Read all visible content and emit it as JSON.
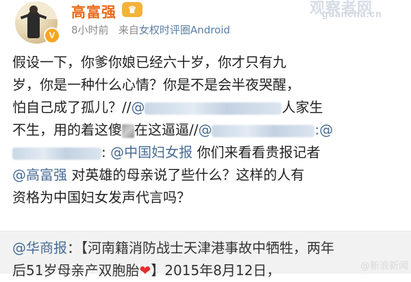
{
  "header": {
    "username": "高富强",
    "vip_badge": "VIP",
    "verified_badge": "V",
    "time": "8小时前",
    "source_prefix": "来自",
    "source": "女权时评圈Android",
    "watermark_site": "观察者网",
    "watermark_url": "guancha.cn"
  },
  "post": {
    "lines": [
      {
        "text": "假设一下，你爹你娘已经六十岁，你才只有九"
      },
      {
        "text": "岁，你是一种什么心情？你是不是会半夜哭醒，"
      },
      {
        "pre": "怕自己成了孤儿？//",
        "mention": "@",
        "post": "人家生"
      },
      {
        "pre": "不生，用的着这傻",
        "post": "在这逼逼//",
        "mention": "@",
        "tail": ":@"
      },
      {
        "lead": ": ",
        "mention": "@中国妇女报",
        "post": " 你们来看看贵报记者"
      },
      {
        "mention": "@高富强",
        "post": " 对英雄的母亲说了些什么？这样的人有"
      },
      {
        "text": "资格为中国妇女发声代言吗？"
      }
    ]
  },
  "repost": {
    "mention": "@华商报",
    "line1_rest": "：【河南籍消防战士天津港事故中牺牲，两年",
    "line2_pre": "后51岁母亲产双胞胎",
    "heart": "❤",
    "line2_post": "】2015年8月12日，",
    "watermark": "@新浪新闻"
  },
  "colors": {
    "username": "#e86a1b",
    "link": "#486c94",
    "meta": "#8a8a8a",
    "repost_bg": "#f2f2f2"
  }
}
